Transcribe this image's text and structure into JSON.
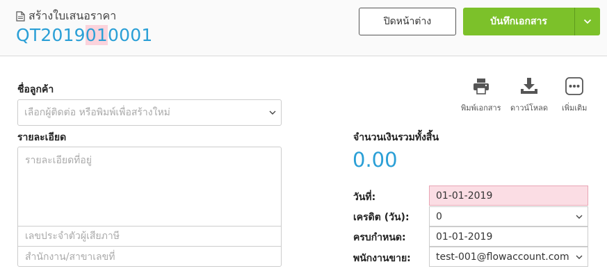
{
  "header": {
    "doc_type": "สร้างใบเสนอราคา",
    "doc_number_prefix": "QT2019",
    "doc_number_highlight": "01",
    "doc_number_suffix": "0001",
    "close_label": "ปิดหน้าต่าง",
    "save_label": "บันทึกเอกสาร"
  },
  "customer": {
    "label": "ชื่อลูกค้า",
    "placeholder": "เลือกผู้ติดต่อ หรือพิมพ์เพื่อสร้างใหม่",
    "details_label": "รายละเอียด",
    "address_placeholder": "รายละเอียดที่อยู่",
    "tax_id_placeholder": "เลขประจำตัวผู้เสียภาษี",
    "branch_placeholder": "สำนักงาน/สาขาเลขที่"
  },
  "tools": {
    "print_label": "พิมพ์เอกสาร",
    "download_label": "ดาวน์โหลด",
    "more_label": "เพิ่มเติม"
  },
  "summary": {
    "total_label": "จำนวนเงินรวมทั้งสิ้น",
    "total_value": "0.00"
  },
  "meta": {
    "date_label": "วันที่:",
    "date_value": "01-01-2019",
    "credit_label": "เครดิต (วัน):",
    "credit_value": "0",
    "due_label": "ครบกำหนด:",
    "due_value": "01-01-2019",
    "salesperson_label": "พนักงานขาย:",
    "salesperson_value": "test-001@flowaccount.com"
  },
  "colors": {
    "accent_blue": "#2a9fd6",
    "save_green": "#7cc12a",
    "highlight_pink": "#fbdde4"
  }
}
